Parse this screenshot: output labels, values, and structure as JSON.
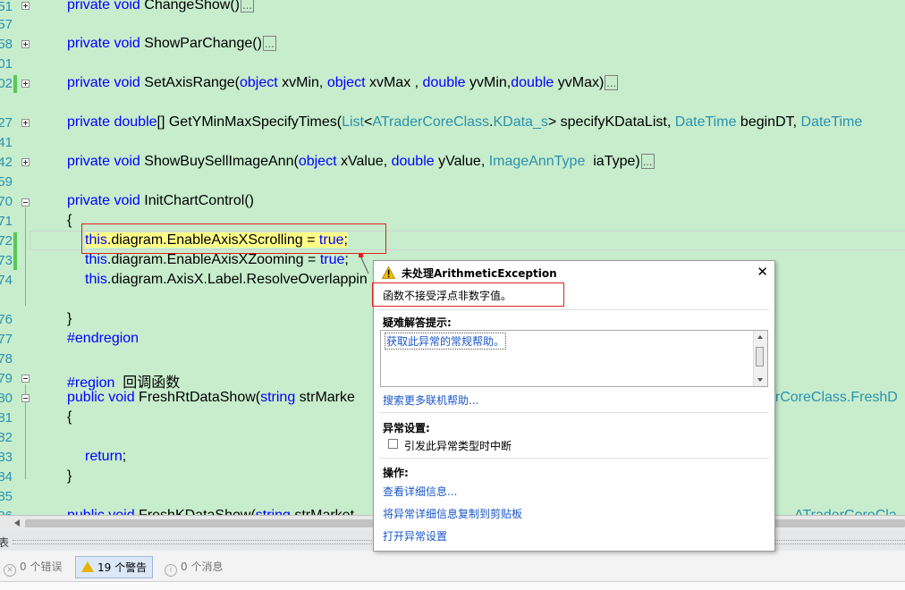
{
  "line_numbers": [
    "51",
    "57",
    "58",
    "01",
    "02",
    "27",
    "41",
    "42",
    "59",
    "70",
    "71",
    "72",
    "73",
    "74",
    "76",
    "77",
    "78",
    "79",
    "80",
    "81",
    "82",
    "83",
    "84",
    "85",
    "86"
  ],
  "code": {
    "l1": {
      "kw": "private void ",
      "name": "ChangeShow()",
      "collapsed": "..."
    },
    "l2": {
      "kw": "private void ",
      "name": "ShowParChange()",
      "collapsed": "..."
    },
    "l3": {
      "kw": "private void ",
      "name": "SetAxisRange(",
      "p1t": "object",
      "p1": " xvMin, ",
      "p2t": "object",
      "p2": " xvMax , ",
      "p3t": "double",
      "p3": " yvMin,",
      "p4t": "double",
      "p4": " yvMax)",
      "collapsed": "..."
    },
    "l4": {
      "kw1": "private ",
      "kw2": "double",
      "rest": "[] GetYMinMaxSpecifyTimes(",
      "t1": "List",
      "lt": "<",
      "t2": "ATraderCoreClass",
      "dot": ".",
      "t3": "KData_s",
      "gt": "> specifyKDataList, ",
      "t4": "DateTime",
      "mid": " beginDT, ",
      "t5": "DateTime"
    },
    "l5": {
      "kw": "private void ",
      "name": "ShowBuySellImageAnn(",
      "p1t": "object",
      "p1": " xValue, ",
      "p2t": "double",
      "p2": " yValue, ",
      "t3": "ImageAnnType",
      "p3": "  iaType)",
      "collapsed": "..."
    },
    "l6": {
      "kw": "private void ",
      "name": "InitChartControl()"
    },
    "l7": "{",
    "l8": {
      "kw": "this",
      "rest": ".diagram.EnableAxisXScrolling = ",
      "val": "true",
      ";": ";"
    },
    "l9": {
      "kw": "this",
      "rest": ".diagram.EnableAxisXZooming = ",
      "val": "true",
      ";": ";"
    },
    "l10": {
      "kw": "this",
      "rest": ".diagram.AxisX.Label.ResolveOverlappin"
    },
    "l11": "}",
    "l12": "#endregion",
    "l13": {
      "kw": "#region",
      "rest": "  回调函数"
    },
    "l14": {
      "kw": "public void ",
      "name": "FreshRtDataShow(",
      "t1": "string",
      "rest": " strMarke",
      "tail1": "erCoreClass",
      "tail2": ".FreshD"
    },
    "l15": "{",
    "l16": {
      "kw": "return",
      ";": ";"
    },
    "l17": "}",
    "l18": {
      "kw": "public void ",
      "name": "FreshKDataShow(",
      "t1": "string",
      "rest": " strMarket",
      "tail1": "ATraderCoreCla"
    }
  },
  "popup": {
    "title": "未处理ArithmeticException",
    "message": "函数不接受浮点非数字值。",
    "tips_heading": "疑难解答提示:",
    "tip_link": "获取此异常的常规帮助。",
    "more_help": "搜索更多联机帮助...",
    "exception_settings_heading": "异常设置:",
    "break_checkbox_label": "引发此异常类型时中断",
    "break_checked": false,
    "actions_heading": "操作:",
    "action_details": "查看详细信息...",
    "action_copy": "将异常详细信息复制到剪贴板",
    "action_open_settings": "打开异常设置"
  },
  "error_list": {
    "panel_label": "表",
    "errors": "0 个错误",
    "warnings": "19 个警告",
    "messages": "0 个消息"
  },
  "colors": {
    "editor_bg": "#c7edcc",
    "keyword": "#0000ff",
    "type": "#2b91af",
    "highlight": "#ffff88",
    "red_box": "#e02020"
  }
}
